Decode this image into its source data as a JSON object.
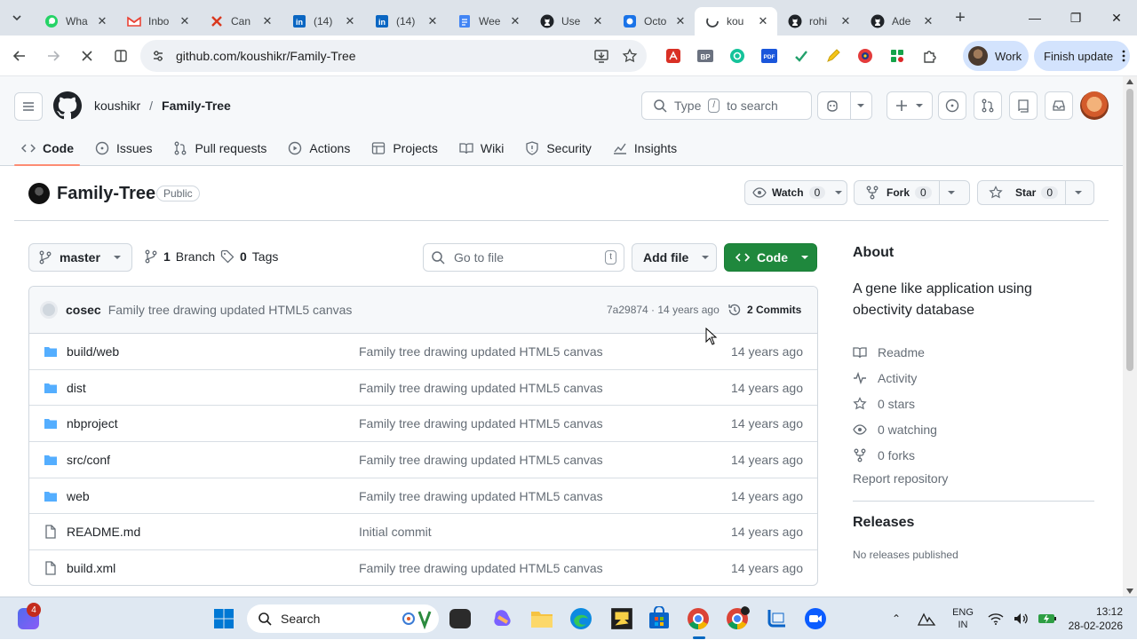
{
  "browser": {
    "tabs": [
      {
        "title": "Wha",
        "icon": "whatsapp-icon"
      },
      {
        "title": "Inbo",
        "icon": "gmail-icon"
      },
      {
        "title": "Can",
        "icon": "canva-icon"
      },
      {
        "title": "(14)",
        "icon": "linkedin-icon"
      },
      {
        "title": "(14)",
        "icon": "linkedin-icon"
      },
      {
        "title": "Wee",
        "icon": "docs-icon"
      },
      {
        "title": "Use",
        "icon": "github-icon"
      },
      {
        "title": "Octo",
        "icon": "octo-icon"
      },
      {
        "title": "kou",
        "icon": "github-icon",
        "active": true
      },
      {
        "title": "rohi",
        "icon": "github-icon"
      },
      {
        "title": "Ade",
        "icon": "github-icon"
      }
    ],
    "url": "github.com/koushikr/Family-Tree",
    "profile_label": "Work",
    "finish_update_label": "Finish update",
    "extensions": [
      "acrobat-ext-icon",
      "bp-ext-icon",
      "grammar-ext-icon",
      "pdf-ext-icon",
      "check-ext-icon",
      "pencil-ext-icon",
      "color-ext-icon",
      "puzzle-ext-icon",
      "extensions-icon"
    ]
  },
  "github": {
    "owner": "koushikr",
    "separator": "/",
    "repo": "Family-Tree",
    "search_prefix": "Type",
    "search_key": "/",
    "search_suffix": "to search",
    "nav": [
      "Code",
      "Issues",
      "Pull requests",
      "Actions",
      "Projects",
      "Wiki",
      "Security",
      "Insights"
    ],
    "visibility": "Public",
    "watch_label": "Watch",
    "watch_count": "0",
    "fork_label": "Fork",
    "fork_count": "0",
    "star_label": "Star",
    "star_count": "0",
    "branch": "master",
    "branches_count": "1",
    "branches_label": "Branch",
    "tags_count": "0",
    "tags_label": "Tags",
    "goto_placeholder": "Go to file",
    "goto_key": "t",
    "add_file_label": "Add file",
    "code_button_label": "Code",
    "latest_commit": {
      "user": "cosec",
      "message": "Family tree drawing updated HTML5 canvas",
      "sha_age": "7a29874 · 14 years ago",
      "commits_label": "2 Commits"
    },
    "files": [
      {
        "name": "build/web",
        "type": "dir",
        "message": "Family tree drawing updated HTML5 canvas",
        "age": "14 years ago"
      },
      {
        "name": "dist",
        "type": "dir",
        "message": "Family tree drawing updated HTML5 canvas",
        "age": "14 years ago"
      },
      {
        "name": "nbproject",
        "type": "dir",
        "message": "Family tree drawing updated HTML5 canvas",
        "age": "14 years ago"
      },
      {
        "name": "src/conf",
        "type": "dir",
        "message": "Family tree drawing updated HTML5 canvas",
        "age": "14 years ago"
      },
      {
        "name": "web",
        "type": "dir",
        "message": "Family tree drawing updated HTML5 canvas",
        "age": "14 years ago"
      },
      {
        "name": "README.md",
        "type": "file",
        "message": "Initial commit",
        "age": "14 years ago"
      },
      {
        "name": "build.xml",
        "type": "file",
        "message": "Family tree drawing updated HTML5 canvas",
        "age": "14 years ago"
      }
    ],
    "about": {
      "title": "About",
      "description": "A gene like application using obectivity database",
      "readme": "Readme",
      "activity": "Activity",
      "stars": "0 stars",
      "watching": "0 watching",
      "forks": "0 forks",
      "report": "Report repository"
    },
    "releases": {
      "title": "Releases",
      "empty": "No releases published"
    }
  },
  "taskbar": {
    "notification_count": "4",
    "search_label": "Search",
    "lang_top": "ENG",
    "lang_bottom": "IN",
    "time": "13:12",
    "date": "28-02-2026"
  },
  "colors": {
    "accent_green": "#1f883d",
    "nav_underline": "#fd8c73",
    "folder_blue": "#54aeff"
  }
}
